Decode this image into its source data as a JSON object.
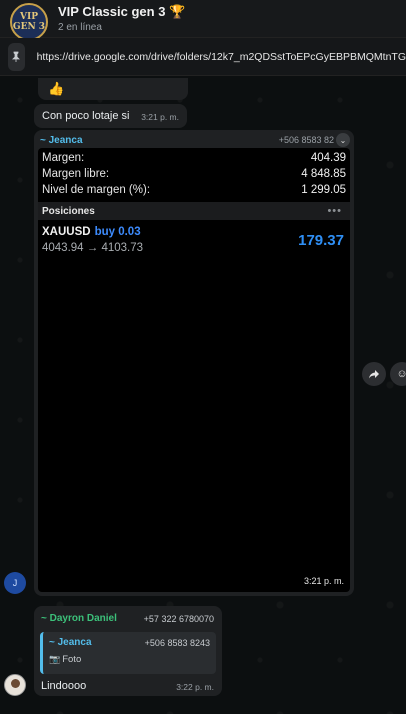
{
  "header": {
    "avatar_line1": "VIP",
    "avatar_line2": "GEN 3",
    "title": "VIP Classic gen 3 🏆",
    "subtitle": "2 en línea"
  },
  "pinned": {
    "icon": "pin-icon",
    "url": "https://drive.google.com/drive/folders/12k7_m2QDSstToEPcGyEBPBMQMtnTG"
  },
  "messages": [
    {
      "type": "reaction",
      "emoji": "👍"
    },
    {
      "type": "text",
      "text": "Con poco lotaje si",
      "time": "3:21 p. m."
    },
    {
      "type": "forwarded_screenshot",
      "sender": "~ Jeanca",
      "phone": "+506 8583 82",
      "time": "3:21 p. m.",
      "screenshot": {
        "rows": [
          {
            "label": "Margen:",
            "value": "404.39"
          },
          {
            "label": "Margen libre:",
            "value": "4 848.85"
          },
          {
            "label": "Nivel de margen (%):",
            "value": "1 299.05"
          }
        ],
        "positions_title": "Posiciones",
        "trade": {
          "symbol": "XAUUSD",
          "side": "buy 0.03",
          "prices": "4043.94 → 4103.73",
          "profit": "179.37"
        }
      }
    },
    {
      "type": "reply",
      "sender": "~ Dayron Daniel",
      "phone": "+57 322 6780070",
      "quote": {
        "sender": "~ Jeanca",
        "phone": "+506 8583 8243",
        "content": "Foto"
      },
      "text": "Lindoooo",
      "time": "3:22 p. m."
    }
  ],
  "avatars": {
    "jeanca_initial": "J"
  },
  "colors": {
    "accent_blue": "#53bdeb",
    "sender_green": "#3cc17a",
    "profit_blue": "#2f8ff5",
    "bubble_bg": "#1f2123"
  }
}
